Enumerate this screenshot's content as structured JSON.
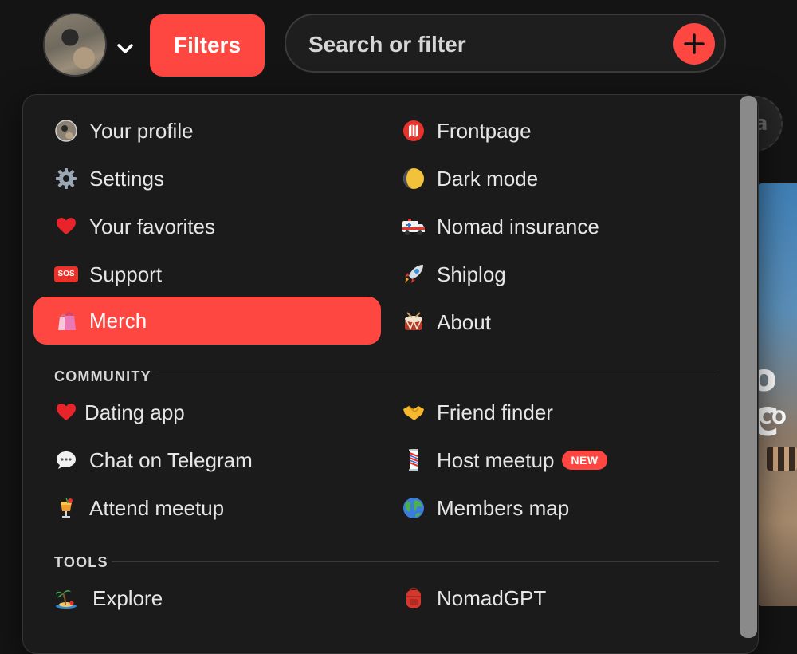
{
  "header": {
    "filters_label": "Filters",
    "search_placeholder": "Search or filter"
  },
  "background": {
    "ad_label": "Ad",
    "circle_letter": "a",
    "card_title": "o C",
    "card_subtitle": "CO"
  },
  "menu": {
    "main_left": [
      {
        "label": "Your profile",
        "icon": "avatar-icon"
      },
      {
        "label": "Settings",
        "icon": "gear-icon"
      },
      {
        "label": "Your favorites",
        "icon": "heart-icon"
      },
      {
        "label": "Support",
        "icon": "sos-icon"
      },
      {
        "label": "Merch",
        "icon": "shopping-bags-icon",
        "active": true
      }
    ],
    "main_right": [
      {
        "label": "Frontpage",
        "icon": "map-icon"
      },
      {
        "label": "Dark mode",
        "icon": "moon-icon"
      },
      {
        "label": "Nomad insurance",
        "icon": "ambulance-icon"
      },
      {
        "label": "Shiplog",
        "icon": "rocket-icon"
      },
      {
        "label": "About",
        "icon": "drum-icon"
      }
    ],
    "community_label": "COMMUNITY",
    "community_left": [
      {
        "label": "Dating app",
        "icon": "heart-icon"
      },
      {
        "label": "Chat on Telegram",
        "icon": "speech-bubble-icon"
      },
      {
        "label": "Attend meetup",
        "icon": "cocktail-icon"
      }
    ],
    "community_right": [
      {
        "label": "Friend finder",
        "icon": "handshake-icon"
      },
      {
        "label": "Host meetup",
        "icon": "barber-pole-icon",
        "badge": "NEW"
      },
      {
        "label": "Members map",
        "icon": "globe-icon"
      }
    ],
    "tools_label": "TOOLS",
    "tools_left": [
      {
        "label": "Explore",
        "icon": "island-icon"
      }
    ],
    "tools_right": [
      {
        "label": "NomadGPT",
        "icon": "backpack-icon"
      }
    ]
  },
  "colors": {
    "accent": "#ff4742",
    "background": "#141414",
    "menu_background": "#1b1b1b"
  }
}
